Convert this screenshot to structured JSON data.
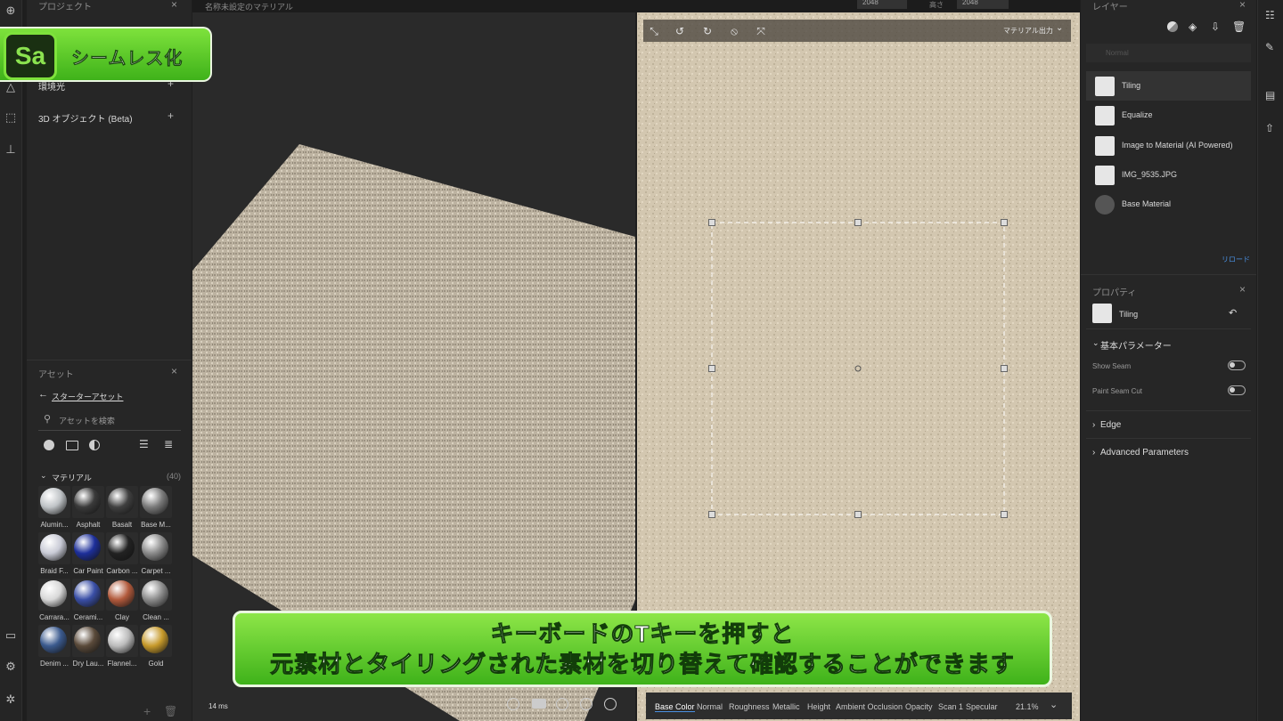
{
  "badge": {
    "logo": "Sa",
    "text": "シームレス化"
  },
  "top": {
    "title": "名称未設定のマテリアル",
    "w_value": "2048",
    "h_label": "高さ",
    "h_value": "2048"
  },
  "left_panel": {
    "project_header": "プロジェクト",
    "rows": [
      {
        "label": "環境光"
      },
      {
        "label": "3D オブジェクト (Beta)"
      }
    ],
    "assets_header": "アセット",
    "back_link": "スターターアセット",
    "search_placeholder": "アセットを検索",
    "materials_label": "マテリアル",
    "materials_count": "(40)",
    "materials": [
      {
        "label": "Alumin...",
        "color": "#bfc3c6"
      },
      {
        "label": "Asphalt",
        "color": "#3a3a3a"
      },
      {
        "label": "Basalt",
        "color": "#404040"
      },
      {
        "label": "Base M...",
        "color": "#7a7a7a"
      },
      {
        "label": "Braid F...",
        "color": "#c9cbd6"
      },
      {
        "label": "Car Paint",
        "color": "#1d2f9a"
      },
      {
        "label": "Carbon ...",
        "color": "#222222"
      },
      {
        "label": "Carpet ...",
        "color": "#8a8a8a"
      },
      {
        "label": "Carrara...",
        "color": "#d8d8d8"
      },
      {
        "label": "Cerami...",
        "color": "#3a4fa6"
      },
      {
        "label": "Clay",
        "color": "#b25a3c"
      },
      {
        "label": "Clean ...",
        "color": "#8c8c8c"
      },
      {
        "label": "Denim ...",
        "color": "#3b5a8e"
      },
      {
        "label": "Dry Lau...",
        "color": "#5a4a3a"
      },
      {
        "label": "Flannel...",
        "color": "#bcbcbc"
      },
      {
        "label": "Gold",
        "color": "#c79a2b"
      }
    ]
  },
  "viewport": {
    "fps": "14 ms",
    "output_label": "マテリアル出力",
    "channels": [
      "Base Color",
      "Normal",
      "Roughness",
      "Metallic",
      "Height",
      "Ambient Occlusion",
      "Opacity",
      "Scan 1",
      "Specular"
    ],
    "zoom": "21.1%"
  },
  "layers": {
    "header": "レイヤー",
    "blend": "Normal",
    "items": [
      {
        "name": "Tiling"
      },
      {
        "name": "Equalize"
      },
      {
        "name": "Image to Material (AI Powered)"
      },
      {
        "name": "IMG_9535.JPG"
      },
      {
        "name": "Base Material"
      }
    ],
    "reload": "リロード"
  },
  "properties": {
    "header": "プロパティ",
    "layer_name": "Tiling",
    "basic_section": "基本パラメーター",
    "show_seam": "Show Seam",
    "paint_seam_cut": "Paint Seam Cut",
    "edge": "Edge",
    "advanced": "Advanced Parameters"
  },
  "caption": {
    "line1": "キーボードのTキーを押すと",
    "line2": "元素材とタイリングされた素材を切り替えて確認することができます"
  }
}
